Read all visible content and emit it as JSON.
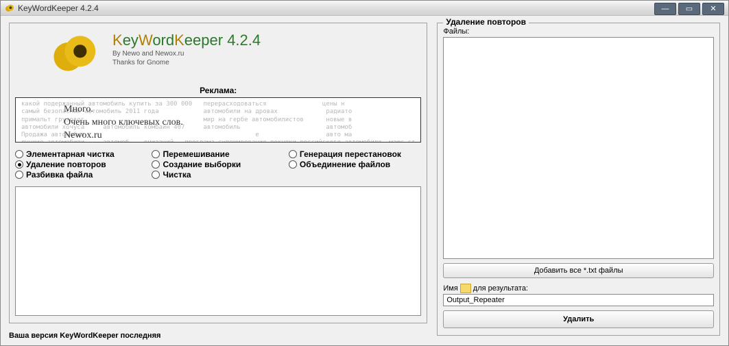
{
  "window": {
    "title": "KeyWordKeeper 4.2.4"
  },
  "brand": {
    "title_k1": "K",
    "title_rest1": "ey",
    "title_k2": "W",
    "title_rest2": "ord",
    "title_k3": "K",
    "title_rest3": "eeper ",
    "version": "4.2.4",
    "by": "By Newo and Newox.ru",
    "thanks": "Thanks for Gnome"
  },
  "ad": {
    "label": "Реклама:",
    "overlay1": "Много.",
    "overlay2": "Очень много ключевых слов.",
    "overlay3": "Newox.ru",
    "bg": "какой подержанный автомобиль купить за 300 000   перерасходоваться               цены н\nсамый безопасный автомобиль 2011 года            автомобили на дровах             радиато\nпримальт грузовог                                мир на гербе автомобилистов      новые в\nавтомобили хочуса     автомобиль комбайн 407     автомобиль                       автомоб\nПродажа автомобил                                              е                  авто ма\nлучшие автомобили     автомоб    онизаций   програма судоширования покупки российского автомобиля  маюс ст\nЛитвинск автомоби     логика            салон автомобилей жилай                   прода"
  },
  "radios": {
    "r1": "Элементарная чистка",
    "r2": "Перемешивание",
    "r3": "Генерация перестановок",
    "r4": "Удаление повторов",
    "r5": "Создание выборки",
    "r6": "Объединение файлов",
    "r7": "Разбивка файла",
    "r8": "Чистка"
  },
  "status": "Ваша версия KeyWordKeeper последняя",
  "right": {
    "legend": "Удаление повторов",
    "files_label": "Файлы:",
    "add_btn": "Добавить все *.txt файлы",
    "folder_prefix": "Имя",
    "folder_suffix": "для результата:",
    "output_value": "Output_Repeater",
    "delete_btn": "Удалить"
  }
}
